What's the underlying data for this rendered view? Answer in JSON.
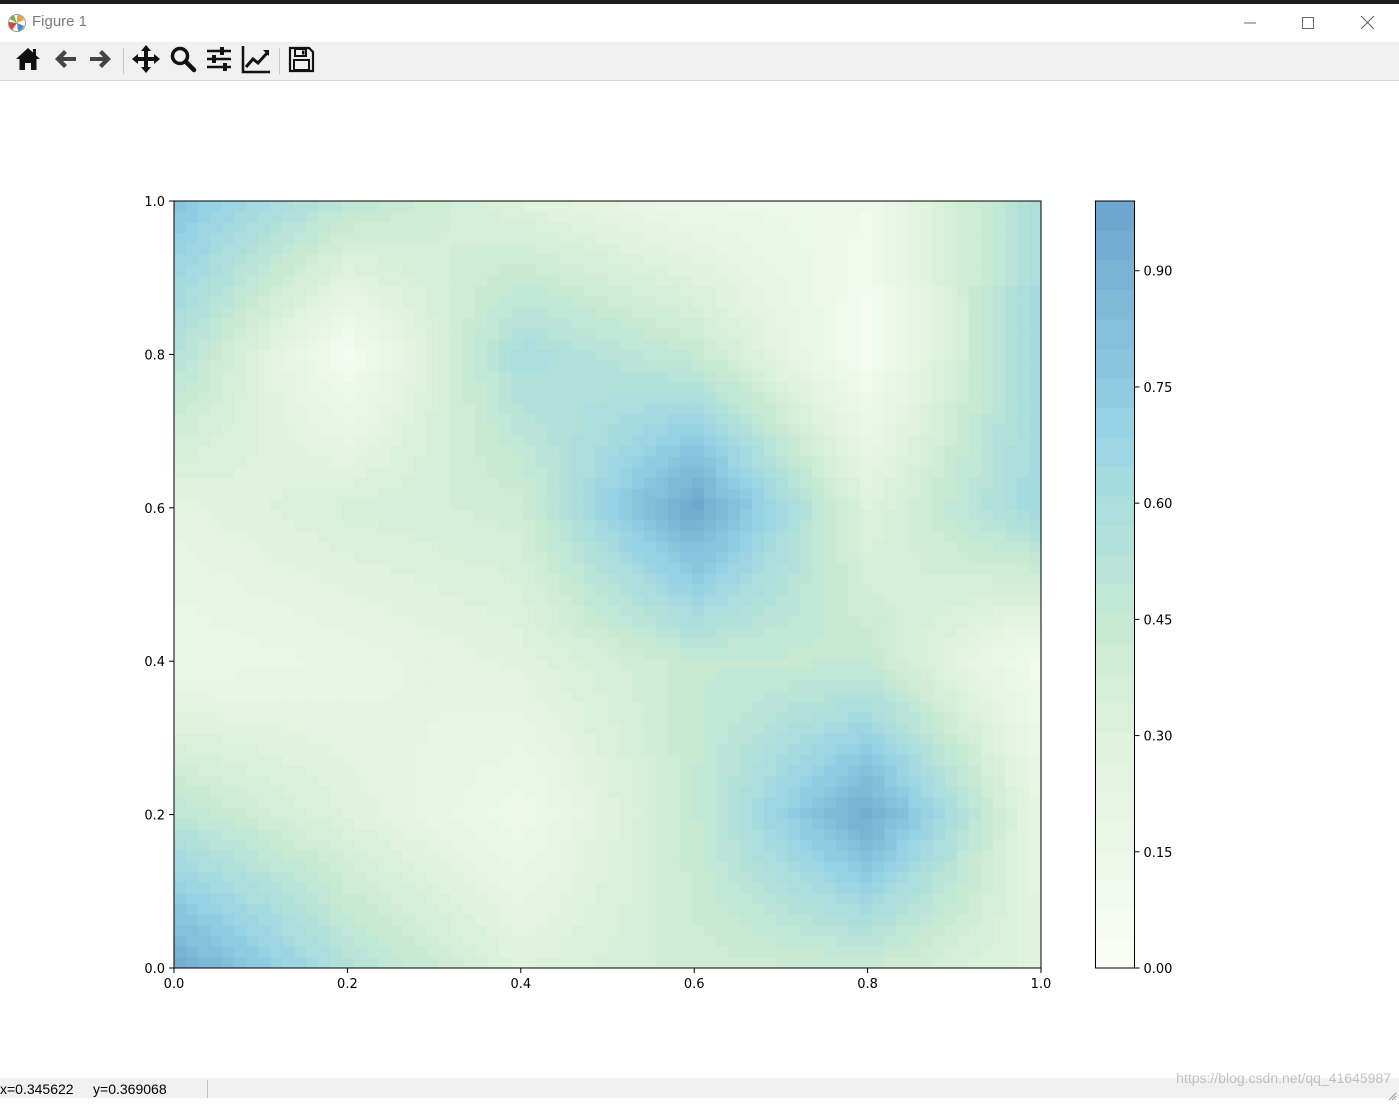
{
  "window": {
    "title": "Figure 1",
    "app_icon": "matplotlib-icon",
    "controls": [
      "minimize-icon",
      "maximize-icon",
      "close-icon"
    ]
  },
  "toolbar": {
    "buttons": [
      {
        "name": "home-icon",
        "tooltip": "Home"
      },
      {
        "name": "back-icon",
        "tooltip": "Back"
      },
      {
        "name": "forward-icon",
        "tooltip": "Forward"
      },
      {
        "name": "pan-icon",
        "tooltip": "Pan"
      },
      {
        "name": "zoom-icon",
        "tooltip": "Zoom"
      },
      {
        "name": "subplots-icon",
        "tooltip": "Subplots"
      },
      {
        "name": "edit-axis-icon",
        "tooltip": "Customize"
      },
      {
        "name": "save-icon",
        "tooltip": "Save"
      }
    ]
  },
  "status": {
    "x_label": "x=0.345622",
    "y_label": "y=0.369068"
  },
  "watermark": "https://blog.csdn.net/qq_41645987",
  "chart_data": {
    "type": "heatmap",
    "subtype": "filled-contour",
    "title": "",
    "xlabel": "",
    "ylabel": "",
    "xlim": [
      0,
      1
    ],
    "ylim": [
      0,
      1
    ],
    "x_ticks": [
      "0.0",
      "0.2",
      "0.4",
      "0.6",
      "0.8",
      "1.0"
    ],
    "y_ticks": [
      "0.0",
      "0.2",
      "0.4",
      "0.6",
      "0.8",
      "1.0"
    ],
    "x": [
      0.0,
      0.2,
      0.4,
      0.6,
      0.8,
      1.0
    ],
    "y": [
      0.0,
      0.2,
      0.4,
      0.6,
      0.8,
      1.0
    ],
    "z": [
      [
        0.95,
        0.55,
        0.3,
        0.4,
        0.42,
        0.28
      ],
      [
        0.5,
        0.3,
        0.12,
        0.45,
        0.95,
        0.22
      ],
      [
        0.15,
        0.2,
        0.28,
        0.45,
        0.45,
        0.08
      ],
      [
        0.25,
        0.35,
        0.4,
        0.98,
        0.3,
        0.65
      ],
      [
        0.55,
        0.05,
        0.6,
        0.45,
        0.05,
        0.65
      ],
      [
        0.78,
        0.5,
        0.3,
        0.15,
        0.12,
        0.6
      ]
    ],
    "levels": 26,
    "colormap": "GnBu",
    "alpha": 0.6,
    "colorbar": {
      "ticks": [
        "0.00",
        "0.15",
        "0.30",
        "0.45",
        "0.60",
        "0.75",
        "0.90"
      ],
      "range": [
        0.0,
        0.99
      ]
    },
    "grid": false
  }
}
